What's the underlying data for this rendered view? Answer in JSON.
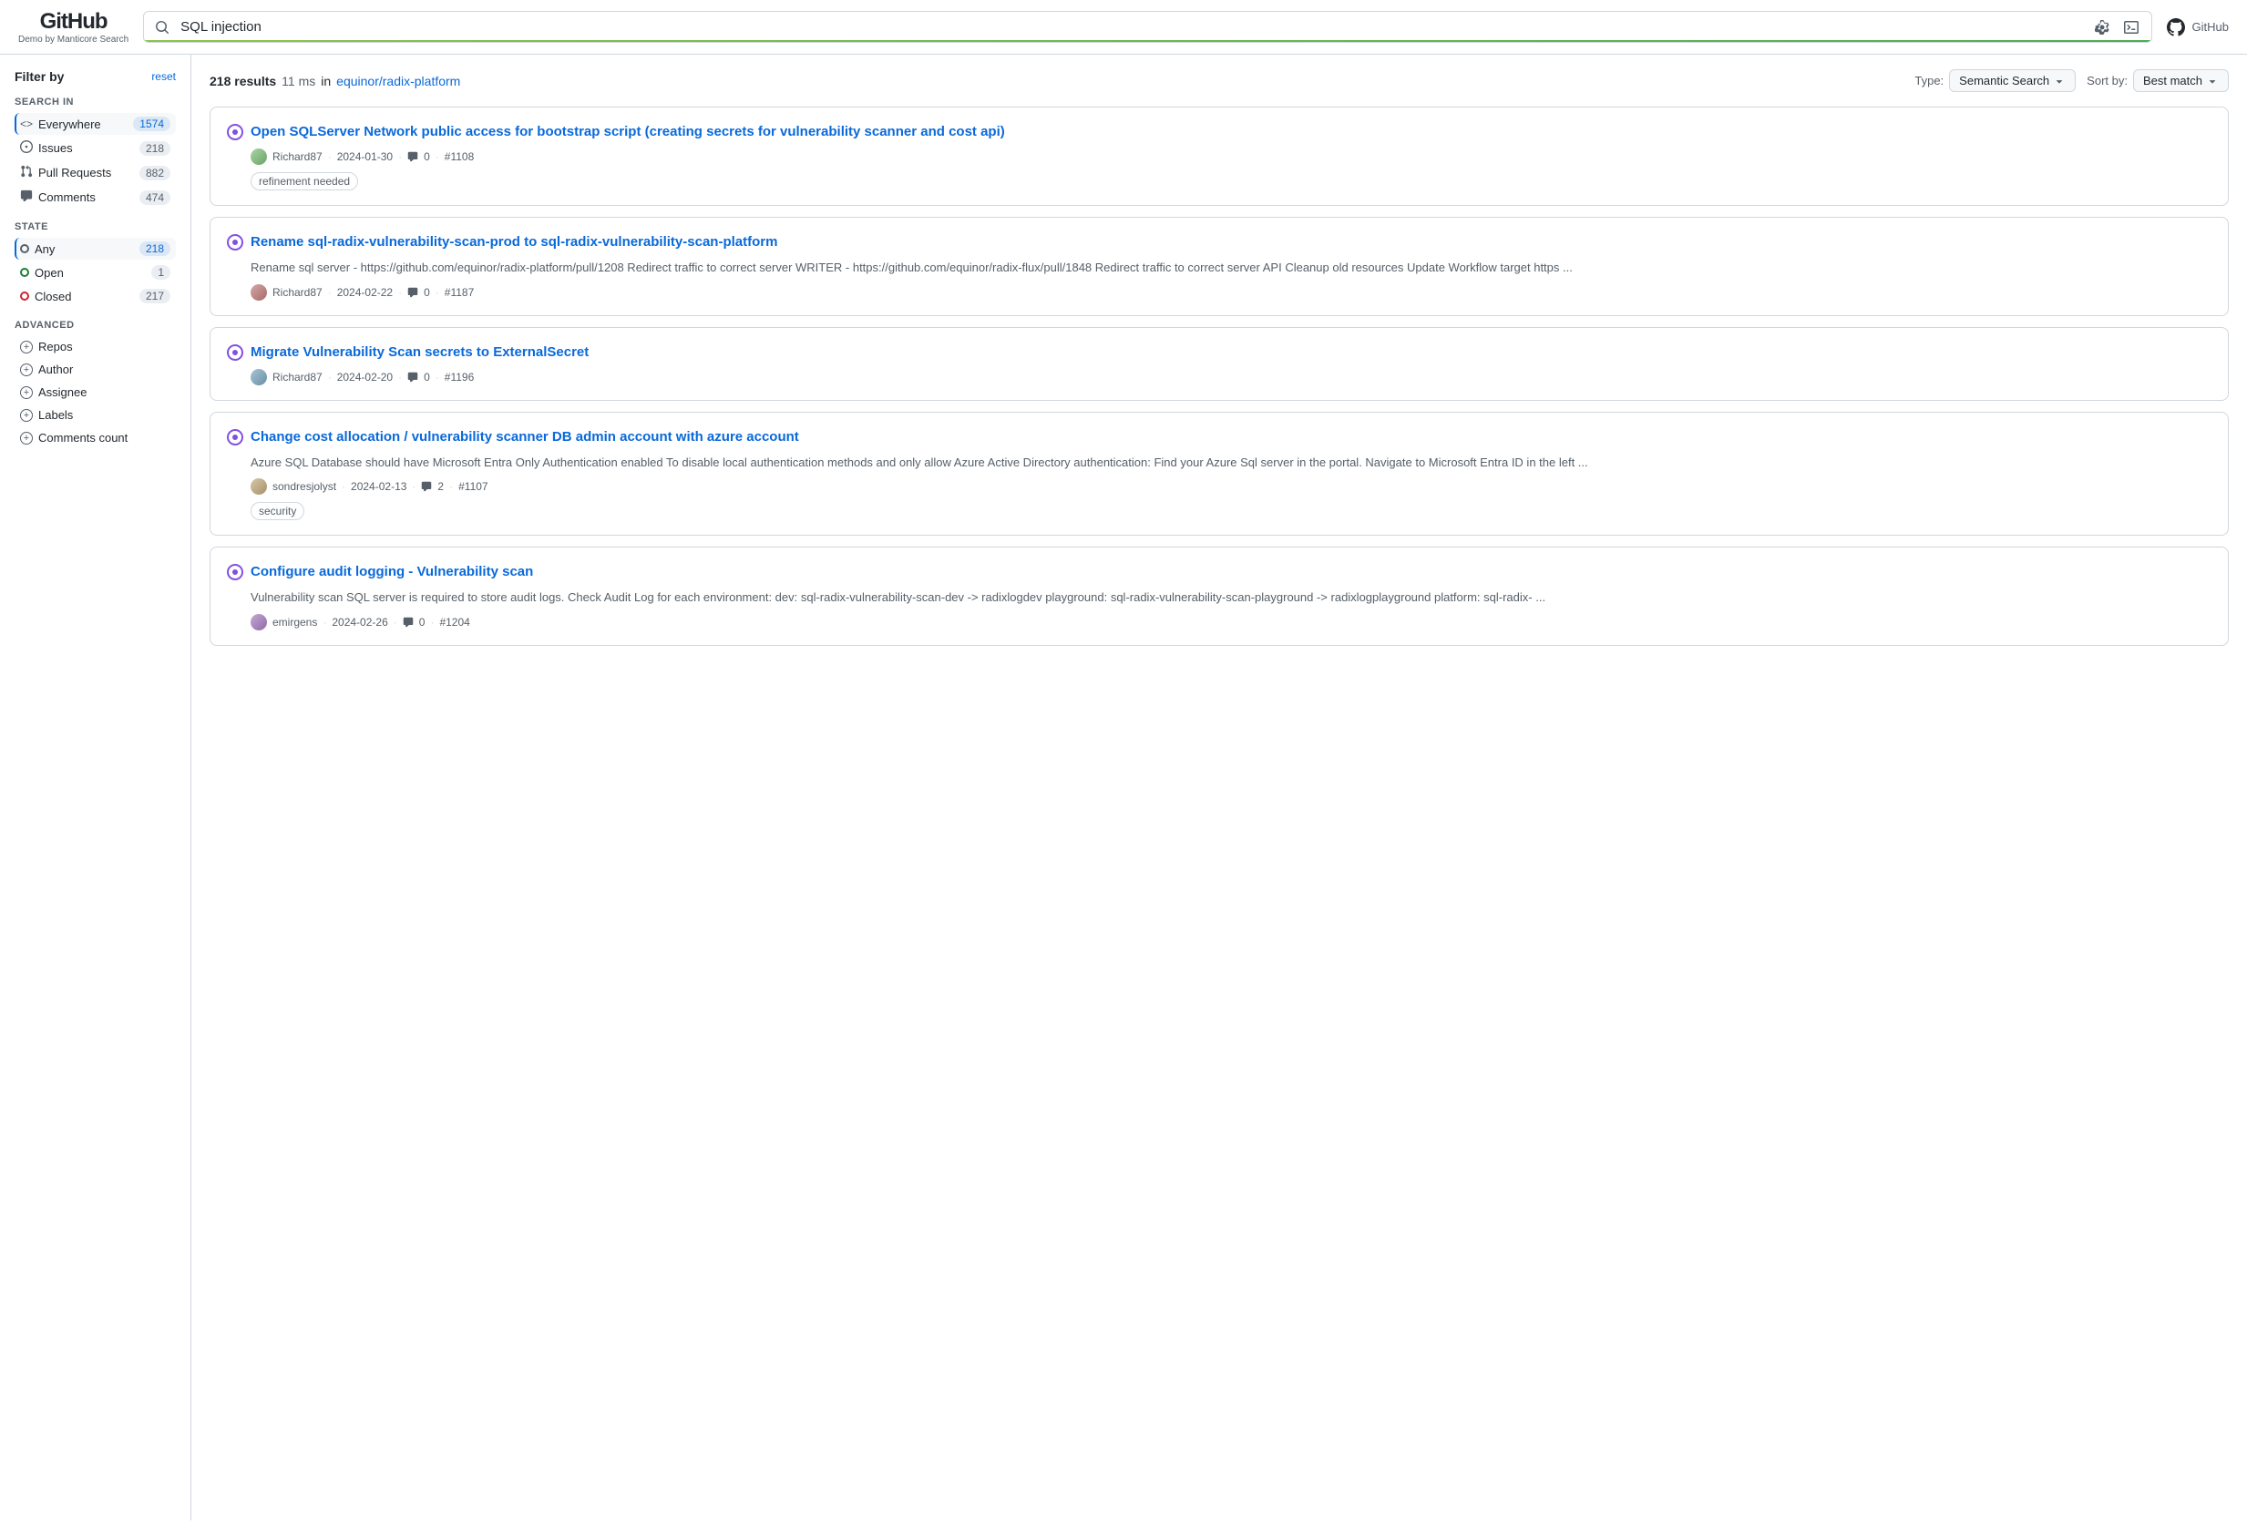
{
  "header": {
    "logo": "GitHub",
    "subtitle": "Demo by Manticore Search",
    "search_value": "SQL injection",
    "github_label": "GitHub"
  },
  "results_bar": {
    "count": "218 results",
    "time": "11 ms",
    "repo_link_text": "equinor/radix-platform",
    "repo_link_href": "#",
    "type_label": "Type:",
    "type_value": "Semantic Search",
    "sort_label": "Sort by:",
    "sort_value": "Best match"
  },
  "sidebar": {
    "filter_by": "Filter by",
    "reset": "reset",
    "search_in_label": "Search in",
    "search_in_items": [
      {
        "icon": "code-icon",
        "label": "Everywhere",
        "count": "1574",
        "active": true
      },
      {
        "icon": "issue-icon",
        "label": "Issues",
        "count": "218"
      },
      {
        "icon": "pr-icon",
        "label": "Pull Requests",
        "count": "882"
      },
      {
        "icon": "comment-icon",
        "label": "Comments",
        "count": "474"
      }
    ],
    "state_label": "State",
    "state_items": [
      {
        "dot": "any",
        "label": "Any",
        "count": "218",
        "active": true
      },
      {
        "dot": "open",
        "label": "Open",
        "count": "1"
      },
      {
        "dot": "closed",
        "label": "Closed",
        "count": "217"
      }
    ],
    "advanced_label": "Advanced",
    "advanced_items": [
      {
        "label": "Repos"
      },
      {
        "label": "Author"
      },
      {
        "label": "Assignee"
      },
      {
        "label": "Labels"
      },
      {
        "label": "Comments count"
      }
    ]
  },
  "results": [
    {
      "title": "Open SQLServer Network public access for bootstrap script (creating secrets for vulnerability scanner and cost api)",
      "href": "#",
      "state": "closed",
      "author": "Richard87",
      "date": "2024-01-30",
      "comments": "0",
      "number": "#1108",
      "body": "",
      "tags": [
        "refinement needed"
      ]
    },
    {
      "title": "Rename sql-radix-vulnerability-scan-prod to sql-radix-vulnerability-scan-platform",
      "href": "#",
      "state": "closed",
      "author": "Richard87",
      "date": "2024-02-22",
      "comments": "0",
      "number": "#1187",
      "body": "Rename sql server - https://github.com/equinor/radix-platform/pull/1208 Redirect traffic to correct server WRITER - https://github.com/equinor/radix-flux/pull/1848 Redirect traffic to correct server API Cleanup old resources Update Workflow target https ...",
      "tags": []
    },
    {
      "title": "Migrate Vulnerability Scan secrets to ExternalSecret",
      "href": "#",
      "state": "closed",
      "author": "Richard87",
      "date": "2024-02-20",
      "comments": "0",
      "number": "#1196",
      "body": "",
      "tags": []
    },
    {
      "title": "Change cost allocation / vulnerability scanner DB admin account with azure account",
      "href": "#",
      "state": "closed",
      "author": "sondresjolyst",
      "date": "2024-02-13",
      "comments": "2",
      "number": "#1107",
      "body": "Azure SQL Database should have Microsoft Entra Only Authentication enabled To disable local authentication methods and only allow Azure Active Directory authentication: Find your Azure Sql server in the portal. Navigate to Microsoft Entra ID in the left ...",
      "tags": [
        "security"
      ]
    },
    {
      "title": "Configure audit logging - Vulnerability scan",
      "href": "#",
      "state": "closed",
      "author": "emirgens",
      "date": "2024-02-26",
      "comments": "0",
      "number": "#1204",
      "body": "Vulnerability scan SQL server is required to store audit logs. Check Audit Log for each environment: dev: sql-radix-vulnerability-scan-dev -> radixlogdev playground: sql-radix-vulnerability-scan-playground -> radixlogplayground platform: sql-radix- ...",
      "tags": []
    }
  ]
}
